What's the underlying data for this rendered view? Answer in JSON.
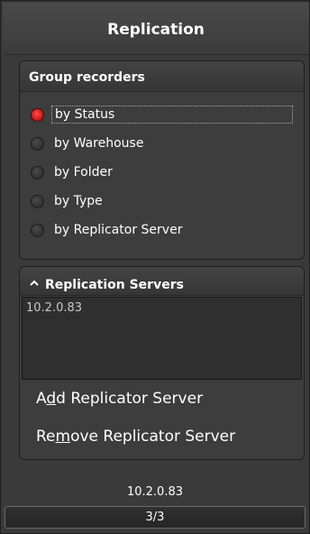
{
  "header": {
    "title": "Replication"
  },
  "group_recorders": {
    "title": "Group recorders",
    "selected": "by Status",
    "options": [
      {
        "label": "by Status",
        "checked": true
      },
      {
        "label": "by Warehouse",
        "checked": false
      },
      {
        "label": "by Folder",
        "checked": false
      },
      {
        "label": "by Type",
        "checked": false
      },
      {
        "label": "by Replicator Server",
        "checked": false
      }
    ]
  },
  "replication_servers": {
    "title": "Replication Servers",
    "items": [
      "10.2.0.83"
    ],
    "add_label_pre": "A",
    "add_label_mn": "d",
    "add_label_post": "d Replicator Server",
    "remove_label_pre": "Re",
    "remove_label_mn": "m",
    "remove_label_post": "ove Replicator Server"
  },
  "status": {
    "ip": "10.2.0.83",
    "page": "3/3"
  },
  "colors": {
    "panel_bg": "#3a3a3a",
    "selected_radio": "#d40000"
  }
}
